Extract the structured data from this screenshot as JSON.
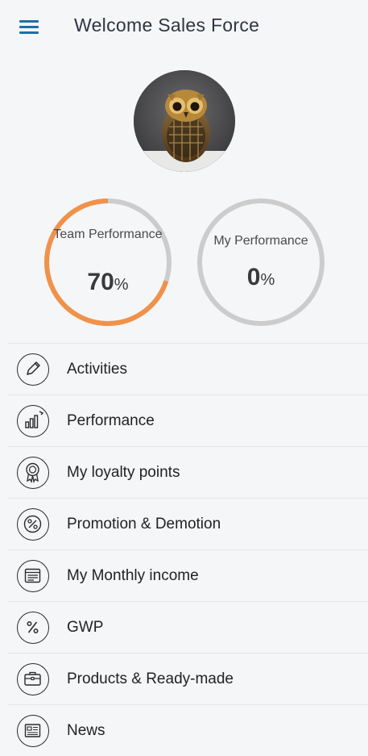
{
  "header": {
    "title": "Welcome Sales Force",
    "menu_icon": "hamburger-menu-icon"
  },
  "profile": {
    "avatar": "owl-profile-photo"
  },
  "performance": {
    "team": {
      "label": "Team Performance",
      "value": "70",
      "unit": "%",
      "fraction": 0.7,
      "color": "#f0924a"
    },
    "mine": {
      "label": "My Performance",
      "value": "0",
      "unit": "%",
      "fraction": 0.0,
      "color": "#f0924a"
    },
    "track_color": "#cccccc"
  },
  "menu": {
    "items": [
      {
        "label": "Activities",
        "icon": "pencil-icon"
      },
      {
        "label": "Performance",
        "icon": "bar-chart-icon"
      },
      {
        "label": "My loyalty points",
        "icon": "award-medal-icon"
      },
      {
        "label": "Promotion & Demotion",
        "icon": "percent-badge-icon"
      },
      {
        "label": "My Monthly income",
        "icon": "calendar-icon"
      },
      {
        "label": "GWP",
        "icon": "percent-icon"
      },
      {
        "label": "Products & Ready-made",
        "icon": "briefcase-icon"
      },
      {
        "label": "News",
        "icon": "newspaper-icon"
      }
    ]
  }
}
